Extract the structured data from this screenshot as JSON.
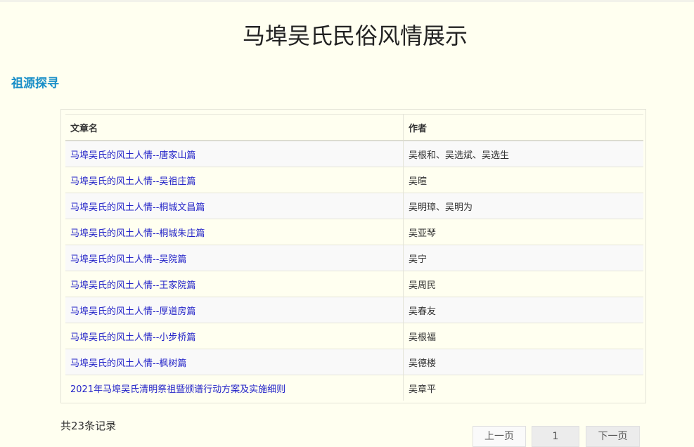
{
  "page": {
    "title": "马埠吴氏民俗风情展示"
  },
  "section": {
    "label": "祖源探寻"
  },
  "table": {
    "headers": [
      "文章名",
      "作者"
    ],
    "rows": [
      {
        "title": "马埠吴氏的风土人情--唐家山篇",
        "author": "吴根和、吴选斌、吴选生"
      },
      {
        "title": "马埠吴氏的风土人情--吴祖庄篇",
        "author": "吴暄"
      },
      {
        "title": "马埠吴氏的风土人情--桐城文昌篇",
        "author": "吴明璋、吴明为"
      },
      {
        "title": "马埠吴氏的风土人情--桐城朱庄篇",
        "author": "吴亚琴"
      },
      {
        "title": "马埠吴氏的风土人情--吴院篇",
        "author": "吴宁"
      },
      {
        "title": "马埠吴氏的风土人情--王家院篇",
        "author": "吴周民"
      },
      {
        "title": "马埠吴氏的风土人情--厚道房篇",
        "author": "吴春友"
      },
      {
        "title": "马埠吴氏的风土人情--小步桥篇",
        "author": "吴根福"
      },
      {
        "title": "马埠吴氏的风土人情--枫树篇",
        "author": "吴德楼"
      },
      {
        "title": "2021年马埠吴氏清明祭祖暨颁谱行动方案及实施细则",
        "author": "吴章平"
      }
    ]
  },
  "footer": {
    "total": "共23条记录"
  },
  "pagination": {
    "prev": "上一页",
    "current": "1",
    "next": "下一页"
  }
}
